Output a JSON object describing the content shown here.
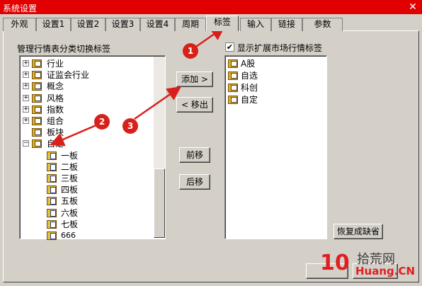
{
  "window": {
    "title": "系统设置"
  },
  "tabs": [
    {
      "label": "外观"
    },
    {
      "label": "设置1"
    },
    {
      "label": "设置2"
    },
    {
      "label": "设置3"
    },
    {
      "label": "设置4"
    },
    {
      "label": "周期"
    },
    {
      "label": "标签",
      "active": true
    },
    {
      "label": "输入"
    },
    {
      "label": "链接"
    },
    {
      "label": "参数"
    }
  ],
  "left_panel": {
    "title": "管理行情表分类切换标签",
    "tree": [
      {
        "label": "行业",
        "expander": "+"
      },
      {
        "label": "证监会行业",
        "expander": "+"
      },
      {
        "label": "概念",
        "expander": "+"
      },
      {
        "label": "风格",
        "expander": "+"
      },
      {
        "label": "指数",
        "expander": "+"
      },
      {
        "label": "组合",
        "expander": "+"
      },
      {
        "label": "板块",
        "expander": ""
      },
      {
        "label": "自定",
        "expander": "-"
      }
    ],
    "subtree": [
      "一板",
      "二板",
      "三板",
      "四板",
      "五板",
      "六板",
      "七板",
      "666"
    ]
  },
  "buttons": {
    "add": "添加 >",
    "remove": "< 移出",
    "move_up": "前移",
    "move_down": "后移",
    "restore": "恢复成缺省"
  },
  "right_panel": {
    "checkbox_label": "显示扩展市场行情标签",
    "checked": true,
    "items": [
      "A股",
      "自选",
      "科创",
      "自定"
    ]
  },
  "markers": [
    "1",
    "2",
    "3"
  ],
  "watermark": {
    "num": "10",
    "cn": "拾荒网",
    "en": "Huang.CN"
  },
  "colors": {
    "titlebar": "#e00000",
    "marker": "#d8201a"
  }
}
